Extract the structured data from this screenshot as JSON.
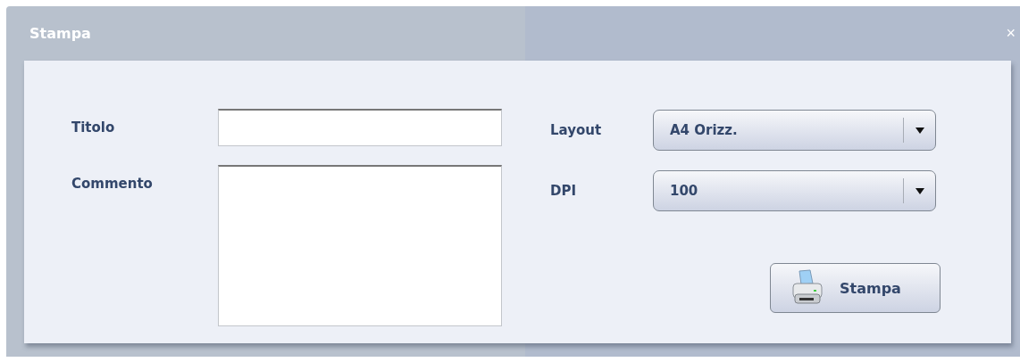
{
  "window": {
    "title": "Stampa",
    "close": "×"
  },
  "left_fields": [
    {
      "label": "Titolo",
      "kind": "text"
    },
    {
      "label": "Commento",
      "kind": "textarea"
    }
  ],
  "right_fields": [
    {
      "label": "Layout",
      "value": "A4 Orizz."
    },
    {
      "label": "DPI",
      "value": "100"
    }
  ],
  "print_button": {
    "label": "Stampa"
  }
}
